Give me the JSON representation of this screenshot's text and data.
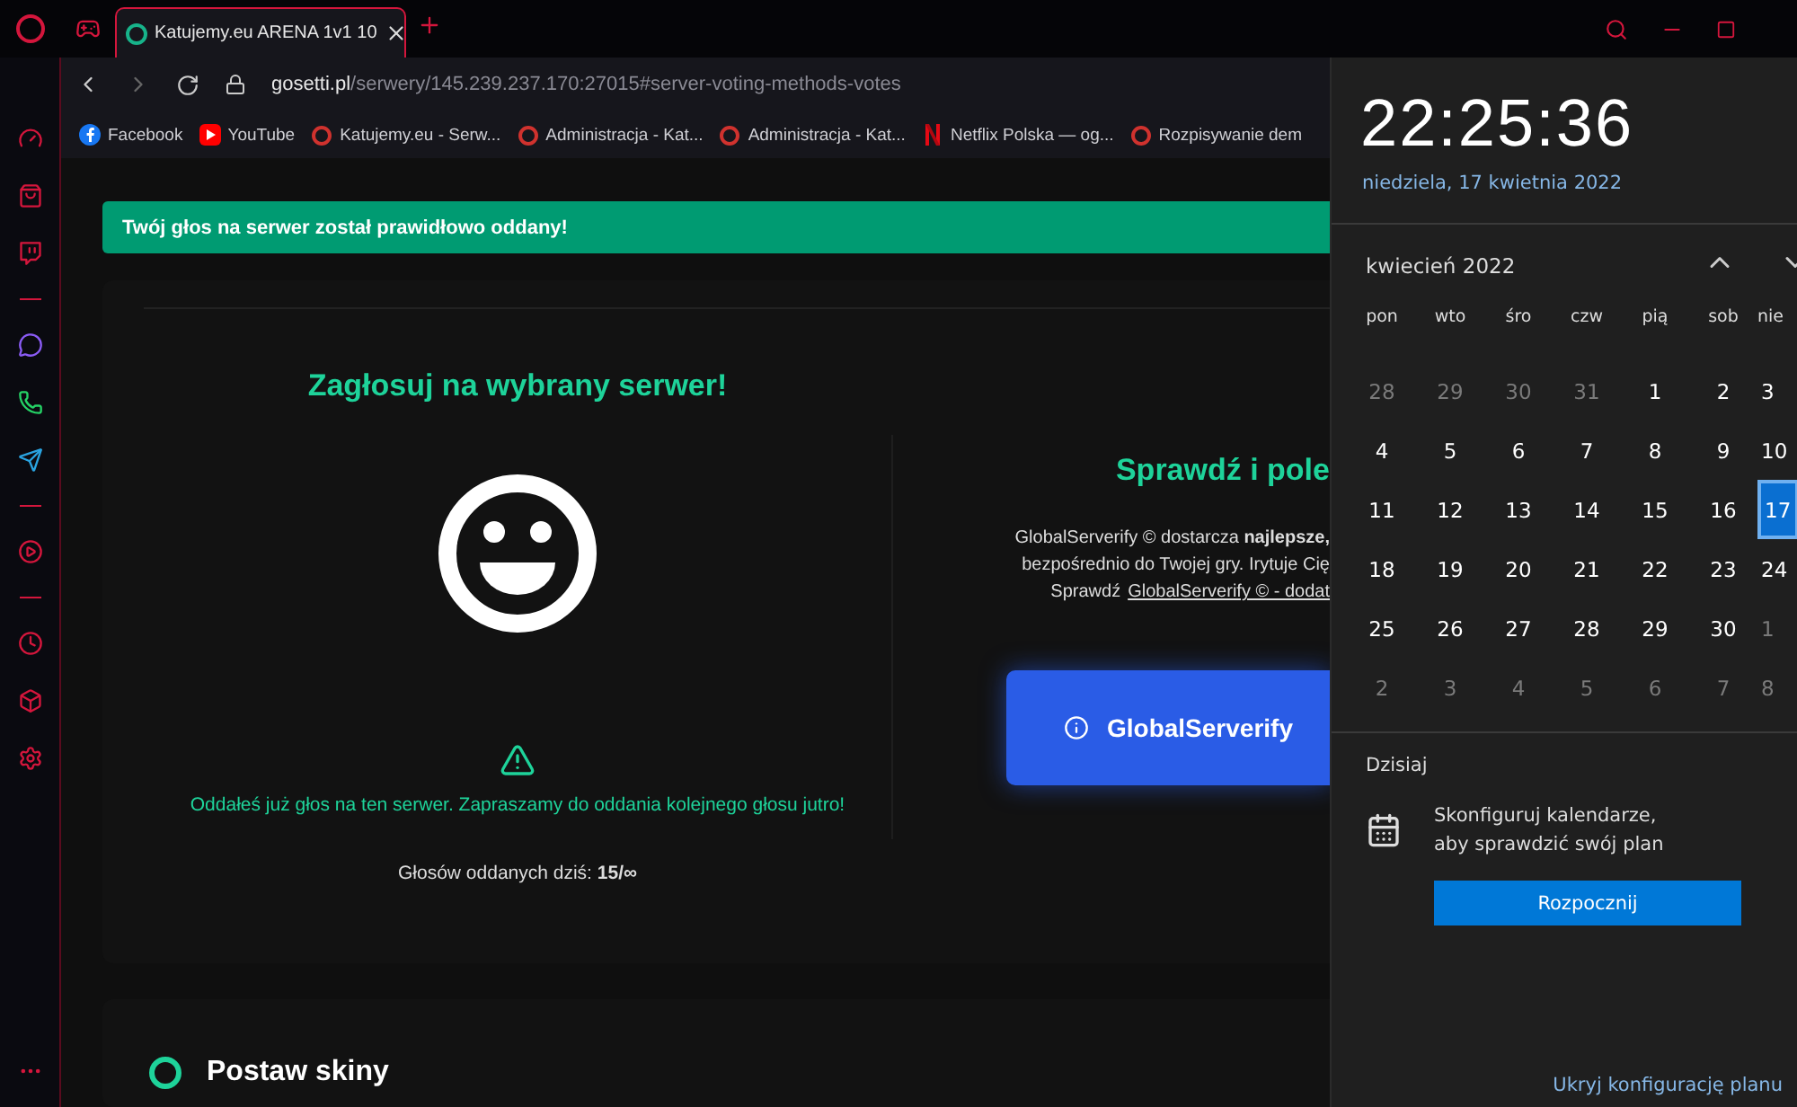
{
  "browser": {
    "tab": {
      "title": "Katujemy.eu ARENA 1v1 10",
      "selected": true
    },
    "url": {
      "domain": "gosetti.pl",
      "path": "/serwery/145.239.237.170:27015#server-voting-methods-votes"
    },
    "bookmarks": [
      {
        "label": "Facebook",
        "kind": "facebook"
      },
      {
        "label": "YouTube",
        "kind": "youtube"
      },
      {
        "label": "Katujemy.eu - Serw...",
        "kind": "site"
      },
      {
        "label": "Administracja - Kat...",
        "kind": "site"
      },
      {
        "label": "Administracja - Kat...",
        "kind": "site"
      },
      {
        "label": "Netflix Polska — og...",
        "kind": "netflix"
      },
      {
        "label": "Rozpisywanie dem",
        "kind": "site"
      }
    ]
  },
  "page": {
    "alert": "Twój głos na serwer został prawidłowo oddany!",
    "vote": {
      "title": "Zagłosuj na wybrany serwer!",
      "message": "Oddałeś już głos na ten serwer. Zapraszamy do oddania kolejnego głosu jutro!",
      "count": "Głosów oddanych dziś: **15/∞**"
    },
    "promo": {
      "title": "Sprawdź i pole",
      "lines": [
        "GlobalServerify © dostarcza **najlepsze,**",
        "bezpośrednio do Twojej gry. Irytuje Cię"
      ],
      "link_prefix": "Sprawdź",
      "link": "GlobalServerify © - dodat",
      "button": "GlobalServerify"
    },
    "next_section": "Postaw skiny"
  },
  "calendar": {
    "time": "22:25:36",
    "date": "niedziela, 17 kwietnia 2022",
    "month": "kwiecień 2022",
    "weekdays": [
      "pon",
      "wto",
      "śro",
      "czw",
      "pią",
      "sob",
      "nie"
    ],
    "weeks": [
      [
        {
          "day": "28",
          "muted": true,
          "selected": false
        },
        {
          "day": "29",
          "muted": true,
          "selected": false
        },
        {
          "day": "30",
          "muted": true,
          "selected": false
        },
        {
          "day": "31",
          "muted": true,
          "selected": false
        },
        {
          "day": "1",
          "muted": false,
          "selected": false
        },
        {
          "day": "2",
          "muted": false,
          "selected": false
        },
        {
          "day": "3",
          "muted": false,
          "selected": false
        }
      ],
      [
        {
          "day": "4",
          "muted": false,
          "selected": false
        },
        {
          "day": "5",
          "muted": false,
          "selected": false
        },
        {
          "day": "6",
          "muted": false,
          "selected": false
        },
        {
          "day": "7",
          "muted": false,
          "selected": false
        },
        {
          "day": "8",
          "muted": false,
          "selected": false
        },
        {
          "day": "9",
          "muted": false,
          "selected": false
        },
        {
          "day": "10",
          "muted": false,
          "selected": false
        }
      ],
      [
        {
          "day": "11",
          "muted": false,
          "selected": false
        },
        {
          "day": "12",
          "muted": false,
          "selected": false
        },
        {
          "day": "13",
          "muted": false,
          "selected": false
        },
        {
          "day": "14",
          "muted": false,
          "selected": false
        },
        {
          "day": "15",
          "muted": false,
          "selected": false
        },
        {
          "day": "16",
          "muted": false,
          "selected": false
        },
        {
          "day": "17",
          "muted": false,
          "selected": true
        }
      ],
      [
        {
          "day": "18",
          "muted": false,
          "selected": false
        },
        {
          "day": "19",
          "muted": false,
          "selected": false
        },
        {
          "day": "20",
          "muted": false,
          "selected": false
        },
        {
          "day": "21",
          "muted": false,
          "selected": false
        },
        {
          "day": "22",
          "muted": false,
          "selected": false
        },
        {
          "day": "23",
          "muted": false,
          "selected": false
        },
        {
          "day": "24",
          "muted": false,
          "selected": false
        }
      ],
      [
        {
          "day": "25",
          "muted": false,
          "selected": false
        },
        {
          "day": "26",
          "muted": false,
          "selected": false
        },
        {
          "day": "27",
          "muted": false,
          "selected": false
        },
        {
          "day": "28",
          "muted": false,
          "selected": false
        },
        {
          "day": "29",
          "muted": false,
          "selected": false
        },
        {
          "day": "30",
          "muted": false,
          "selected": false
        },
        {
          "day": "1",
          "muted": true,
          "selected": false
        }
      ],
      [
        {
          "day": "2",
          "muted": true,
          "selected": false
        },
        {
          "day": "3",
          "muted": true,
          "selected": false
        },
        {
          "day": "4",
          "muted": true,
          "selected": false
        },
        {
          "day": "5",
          "muted": true,
          "selected": false
        },
        {
          "day": "6",
          "muted": true,
          "selected": false
        },
        {
          "day": "7",
          "muted": true,
          "selected": false
        },
        {
          "day": "8",
          "muted": true,
          "selected": false
        }
      ]
    ],
    "today_label": "Dzisiaj",
    "agenda_text": "Skonfiguruj kalendarze, aby sprawdzić swój plan",
    "button": "Rozpocznij",
    "footer_link": "Ukryj konfigurację planu"
  }
}
